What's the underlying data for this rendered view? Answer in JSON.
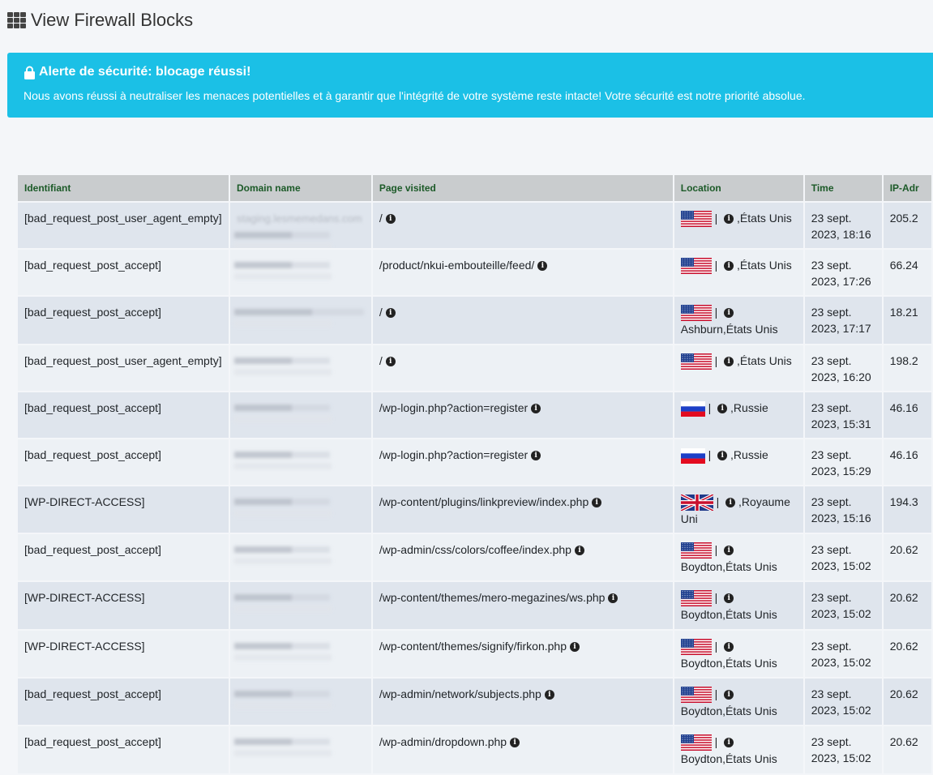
{
  "page": {
    "title": "View Firewall Blocks"
  },
  "alert": {
    "title": "Alerte de sécurité: blocage réussi!",
    "message": "Nous avons réussi à neutraliser les menaces potentielles et à garantir que l'intégrité de votre système reste intacte! Votre sécurité est notre priorité absolue."
  },
  "table": {
    "headers": [
      "Identifiant",
      "Domain name",
      "Page visited",
      "Location",
      "Time",
      "IP-Adr"
    ],
    "rows": [
      {
        "id": "[bad_request_post_user_agent_empty]",
        "domain": "staging.lesmemedans.com",
        "page": "/",
        "flag": "us",
        "location": " ,États Unis",
        "date": "23 sept.",
        "time": "2023, 18:16",
        "ip": "205.2"
      },
      {
        "id": "[bad_request_post_accept]",
        "domain": "",
        "page": "/product/nkui-embouteille/feed/",
        "flag": "us",
        "location": " ,États Unis",
        "date": "23 sept.",
        "time": "2023, 17:26",
        "ip": "66.24"
      },
      {
        "id": "[bad_request_post_accept]",
        "domain": "",
        "page": "/",
        "flag": "us",
        "location": "Ashburn,États Unis",
        "date": "23 sept.",
        "time": "2023, 17:17",
        "ip": "18.21"
      },
      {
        "id": "[bad_request_post_user_agent_empty]",
        "domain": "",
        "page": "/",
        "flag": "us",
        "location": " ,États Unis",
        "date": "23 sept.",
        "time": "2023, 16:20",
        "ip": "198.2"
      },
      {
        "id": "[bad_request_post_accept]",
        "domain": "",
        "page": "/wp-login.php?action=register",
        "flag": "ru",
        "location": " ,Russie",
        "date": "23 sept.",
        "time": "2023, 15:31",
        "ip": "46.16"
      },
      {
        "id": "[bad_request_post_accept]",
        "domain": "",
        "page": "/wp-login.php?action=register",
        "flag": "ru",
        "location": " ,Russie",
        "date": "23 sept.",
        "time": "2023, 15:29",
        "ip": "46.16"
      },
      {
        "id": "[WP-DIRECT-ACCESS]",
        "domain": "",
        "page": "/wp-content/plugins/linkpreview/index.php",
        "flag": "gb",
        "location": " ,Royaume Uni",
        "date": "23 sept.",
        "time": "2023, 15:16",
        "ip": "194.3"
      },
      {
        "id": "[bad_request_post_accept]",
        "domain": "",
        "page": "/wp-admin/css/colors/coffee/index.php",
        "flag": "us",
        "location": "Boydton,États Unis",
        "date": "23 sept.",
        "time": "2023, 15:02",
        "ip": "20.62"
      },
      {
        "id": "[WP-DIRECT-ACCESS]",
        "domain": "",
        "page": "/wp-content/themes/mero-megazines/ws.php",
        "flag": "us",
        "location": "Boydton,États Unis",
        "date": "23 sept.",
        "time": "2023, 15:02",
        "ip": "20.62"
      },
      {
        "id": "[WP-DIRECT-ACCESS]",
        "domain": "",
        "page": "/wp-content/themes/signify/firkon.php",
        "flag": "us",
        "location": "Boydton,États Unis",
        "date": "23 sept.",
        "time": "2023, 15:02",
        "ip": "20.62"
      },
      {
        "id": "[bad_request_post_accept]",
        "domain": "",
        "page": "/wp-admin/network/subjects.php",
        "flag": "us",
        "location": "Boydton,États Unis",
        "date": "23 sept.",
        "time": "2023, 15:02",
        "ip": "20.62"
      },
      {
        "id": "[bad_request_post_accept]",
        "domain": "",
        "page": "/wp-admin/dropdown.php",
        "flag": "us",
        "location": "Boydton,États Unis",
        "date": "23 sept.",
        "time": "2023, 15:02",
        "ip": "20.62"
      }
    ]
  },
  "icons": {
    "header": "th-icon",
    "alert": "lock-icon",
    "info": "info-circle-icon"
  },
  "colors": {
    "alert_bg": "#1bc0e6",
    "header_text": "#1c5a28",
    "header_bg": "#c9ccce"
  }
}
